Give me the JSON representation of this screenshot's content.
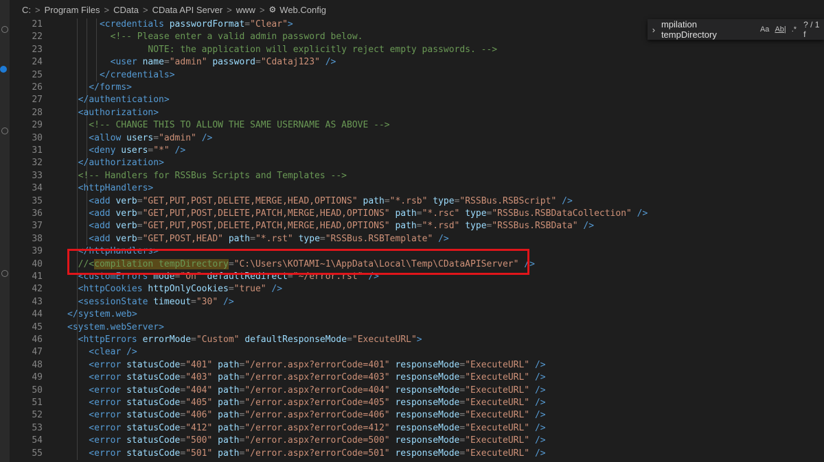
{
  "breadcrumb": [
    "C:",
    "Program Files",
    "CData",
    "CData API Server",
    "www",
    "Web.Config"
  ],
  "find_widget": {
    "term": "mpilation tempDirectory",
    "match_case": "Aa",
    "whole_word": "Ab|",
    "regex": ".*",
    "count": "? / 1 f"
  },
  "line_numbers": [
    "21",
    "22",
    "23",
    "24",
    "25",
    "26",
    "27",
    "28",
    "29",
    "30",
    "31",
    "32",
    "33",
    "34",
    "35",
    "36",
    "37",
    "38",
    "39",
    "40",
    "41",
    "42",
    "43",
    "44",
    "45",
    "46",
    "47",
    "48",
    "49",
    "50",
    "51",
    "52",
    "53",
    "54",
    "55"
  ],
  "code_lines": [
    [
      [
        "      <",
        "t"
      ],
      [
        "credentials",
        "t"
      ],
      [
        " passwordFormat",
        "a"
      ],
      [
        "=",
        "p"
      ],
      [
        "\"Clear\"",
        "s"
      ],
      [
        ">",
        "t"
      ]
    ],
    [
      [
        "        <!-- Please enter a valid admin password below.",
        "c"
      ]
    ],
    [
      [
        "               NOTE: the application will explicitly reject empty passwords. -->",
        "c"
      ]
    ],
    [
      [
        "        <",
        "t"
      ],
      [
        "user",
        "t"
      ],
      [
        " name",
        "a"
      ],
      [
        "=",
        "p"
      ],
      [
        "\"admin\"",
        "s"
      ],
      [
        " password",
        "a"
      ],
      [
        "=",
        "p"
      ],
      [
        "\"Cdataj123\"",
        "s"
      ],
      [
        " />",
        "t"
      ]
    ],
    [
      [
        "      </",
        "t"
      ],
      [
        "credentials",
        "t"
      ],
      [
        ">",
        "t"
      ]
    ],
    [
      [
        "    </",
        "t"
      ],
      [
        "forms",
        "t"
      ],
      [
        ">",
        "t"
      ]
    ],
    [
      [
        "  </",
        "t"
      ],
      [
        "authentication",
        "t"
      ],
      [
        ">",
        "t"
      ]
    ],
    [
      [
        "  <",
        "t"
      ],
      [
        "authorization",
        "t"
      ],
      [
        ">",
        "t"
      ]
    ],
    [
      [
        "    <!-- CHANGE THIS TO ALLOW THE SAME USERNAME AS ABOVE -->",
        "c"
      ]
    ],
    [
      [
        "    <",
        "t"
      ],
      [
        "allow",
        "t"
      ],
      [
        " users",
        "a"
      ],
      [
        "=",
        "p"
      ],
      [
        "\"admin\"",
        "s"
      ],
      [
        " />",
        "t"
      ]
    ],
    [
      [
        "    <",
        "t"
      ],
      [
        "deny",
        "t"
      ],
      [
        " users",
        "a"
      ],
      [
        "=",
        "p"
      ],
      [
        "\"*\"",
        "s"
      ],
      [
        " />",
        "t"
      ]
    ],
    [
      [
        "  </",
        "t"
      ],
      [
        "authorization",
        "t"
      ],
      [
        ">",
        "t"
      ]
    ],
    [
      [
        "  <!-- Handlers for RSSBus Scripts and Templates -->",
        "c"
      ]
    ],
    [
      [
        "  <",
        "t"
      ],
      [
        "httpHandlers",
        "t"
      ],
      [
        ">",
        "t"
      ]
    ],
    [
      [
        "    <",
        "t"
      ],
      [
        "add",
        "t"
      ],
      [
        " verb",
        "a"
      ],
      [
        "=",
        "p"
      ],
      [
        "\"GET,PUT,POST,DELETE,MERGE,HEAD,OPTIONS\"",
        "s"
      ],
      [
        " path",
        "a"
      ],
      [
        "=",
        "p"
      ],
      [
        "\"*.rsb\"",
        "s"
      ],
      [
        " type",
        "a"
      ],
      [
        "=",
        "p"
      ],
      [
        "\"RSSBus.RSBScript\"",
        "s"
      ],
      [
        " />",
        "t"
      ]
    ],
    [
      [
        "    <",
        "t"
      ],
      [
        "add",
        "t"
      ],
      [
        " verb",
        "a"
      ],
      [
        "=",
        "p"
      ],
      [
        "\"GET,PUT,POST,DELETE,PATCH,MERGE,HEAD,OPTIONS\"",
        "s"
      ],
      [
        " path",
        "a"
      ],
      [
        "=",
        "p"
      ],
      [
        "\"*.rsc\"",
        "s"
      ],
      [
        " type",
        "a"
      ],
      [
        "=",
        "p"
      ],
      [
        "\"RSSBus.RSBDataCollection\"",
        "s"
      ],
      [
        " />",
        "t"
      ]
    ],
    [
      [
        "    <",
        "t"
      ],
      [
        "add",
        "t"
      ],
      [
        " verb",
        "a"
      ],
      [
        "=",
        "p"
      ],
      [
        "\"GET,PUT,POST,DELETE,PATCH,MERGE,HEAD,OPTIONS\"",
        "s"
      ],
      [
        " path",
        "a"
      ],
      [
        "=",
        "p"
      ],
      [
        "\"*.rsd\"",
        "s"
      ],
      [
        " type",
        "a"
      ],
      [
        "=",
        "p"
      ],
      [
        "\"RSSBus.RSBData\"",
        "s"
      ],
      [
        " />",
        "t"
      ]
    ],
    [
      [
        "    <",
        "t"
      ],
      [
        "add",
        "t"
      ],
      [
        " verb",
        "a"
      ],
      [
        "=",
        "p"
      ],
      [
        "\"GET,POST,HEAD\"",
        "s"
      ],
      [
        " path",
        "a"
      ],
      [
        "=",
        "p"
      ],
      [
        "\"*.rst\"",
        "s"
      ],
      [
        " type",
        "a"
      ],
      [
        "=",
        "p"
      ],
      [
        "\"RSSBus.RSBTemplate\"",
        "s"
      ],
      [
        " />",
        "t"
      ]
    ],
    [
      [
        "  </",
        "t"
      ],
      [
        "httpHandlers",
        "t"
      ],
      [
        ">",
        "t"
      ]
    ],
    [
      [
        "  //<",
        "c"
      ],
      [
        "compilation tempDirectory",
        "chl"
      ],
      [
        "=",
        "p"
      ],
      [
        "\"C:\\Users\\KOTAMI~1\\AppData\\Local\\Temp\\CDataAPIServer\"",
        "s"
      ],
      [
        " />",
        "t"
      ]
    ],
    [
      [
        "  <",
        "t"
      ],
      [
        "customErrors",
        "t"
      ],
      [
        " mode",
        "a"
      ],
      [
        "=",
        "p"
      ],
      [
        "\"On\"",
        "s"
      ],
      [
        " defaultRedirect",
        "a"
      ],
      [
        "=",
        "p"
      ],
      [
        "\"~/error.rst\"",
        "s"
      ],
      [
        " />",
        "t"
      ]
    ],
    [
      [
        "  <",
        "t"
      ],
      [
        "httpCookies",
        "t"
      ],
      [
        " httpOnlyCookies",
        "a"
      ],
      [
        "=",
        "p"
      ],
      [
        "\"true\"",
        "s"
      ],
      [
        " />",
        "t"
      ]
    ],
    [
      [
        "  <",
        "t"
      ],
      [
        "sessionState",
        "t"
      ],
      [
        " timeout",
        "a"
      ],
      [
        "=",
        "p"
      ],
      [
        "\"30\"",
        "s"
      ],
      [
        " />",
        "t"
      ]
    ],
    [
      [
        "</",
        "t"
      ],
      [
        "system.web",
        "t"
      ],
      [
        ">",
        "t"
      ]
    ],
    [
      [
        "<",
        "t"
      ],
      [
        "system.webServer",
        "t"
      ],
      [
        ">",
        "t"
      ]
    ],
    [
      [
        "  <",
        "t"
      ],
      [
        "httpErrors",
        "t"
      ],
      [
        " errorMode",
        "a"
      ],
      [
        "=",
        "p"
      ],
      [
        "\"Custom\"",
        "s"
      ],
      [
        " defaultResponseMode",
        "a"
      ],
      [
        "=",
        "p"
      ],
      [
        "\"ExecuteURL\"",
        "s"
      ],
      [
        ">",
        "t"
      ]
    ],
    [
      [
        "    <",
        "t"
      ],
      [
        "clear",
        "t"
      ],
      [
        " />",
        "t"
      ]
    ],
    [
      [
        "    <",
        "t"
      ],
      [
        "error",
        "t"
      ],
      [
        " statusCode",
        "a"
      ],
      [
        "=",
        "p"
      ],
      [
        "\"401\"",
        "s"
      ],
      [
        " path",
        "a"
      ],
      [
        "=",
        "p"
      ],
      [
        "\"/error.aspx?errorCode=401\"",
        "s"
      ],
      [
        " responseMode",
        "a"
      ],
      [
        "=",
        "p"
      ],
      [
        "\"ExecuteURL\"",
        "s"
      ],
      [
        " />",
        "t"
      ]
    ],
    [
      [
        "    <",
        "t"
      ],
      [
        "error",
        "t"
      ],
      [
        " statusCode",
        "a"
      ],
      [
        "=",
        "p"
      ],
      [
        "\"403\"",
        "s"
      ],
      [
        " path",
        "a"
      ],
      [
        "=",
        "p"
      ],
      [
        "\"/error.aspx?errorCode=403\"",
        "s"
      ],
      [
        " responseMode",
        "a"
      ],
      [
        "=",
        "p"
      ],
      [
        "\"ExecuteURL\"",
        "s"
      ],
      [
        " />",
        "t"
      ]
    ],
    [
      [
        "    <",
        "t"
      ],
      [
        "error",
        "t"
      ],
      [
        " statusCode",
        "a"
      ],
      [
        "=",
        "p"
      ],
      [
        "\"404\"",
        "s"
      ],
      [
        " path",
        "a"
      ],
      [
        "=",
        "p"
      ],
      [
        "\"/error.aspx?errorCode=404\"",
        "s"
      ],
      [
        " responseMode",
        "a"
      ],
      [
        "=",
        "p"
      ],
      [
        "\"ExecuteURL\"",
        "s"
      ],
      [
        " />",
        "t"
      ]
    ],
    [
      [
        "    <",
        "t"
      ],
      [
        "error",
        "t"
      ],
      [
        " statusCode",
        "a"
      ],
      [
        "=",
        "p"
      ],
      [
        "\"405\"",
        "s"
      ],
      [
        " path",
        "a"
      ],
      [
        "=",
        "p"
      ],
      [
        "\"/error.aspx?errorCode=405\"",
        "s"
      ],
      [
        " responseMode",
        "a"
      ],
      [
        "=",
        "p"
      ],
      [
        "\"ExecuteURL\"",
        "s"
      ],
      [
        " />",
        "t"
      ]
    ],
    [
      [
        "    <",
        "t"
      ],
      [
        "error",
        "t"
      ],
      [
        " statusCode",
        "a"
      ],
      [
        "=",
        "p"
      ],
      [
        "\"406\"",
        "s"
      ],
      [
        " path",
        "a"
      ],
      [
        "=",
        "p"
      ],
      [
        "\"/error.aspx?errorCode=406\"",
        "s"
      ],
      [
        " responseMode",
        "a"
      ],
      [
        "=",
        "p"
      ],
      [
        "\"ExecuteURL\"",
        "s"
      ],
      [
        " />",
        "t"
      ]
    ],
    [
      [
        "    <",
        "t"
      ],
      [
        "error",
        "t"
      ],
      [
        " statusCode",
        "a"
      ],
      [
        "=",
        "p"
      ],
      [
        "\"412\"",
        "s"
      ],
      [
        " path",
        "a"
      ],
      [
        "=",
        "p"
      ],
      [
        "\"/error.aspx?errorCode=412\"",
        "s"
      ],
      [
        " responseMode",
        "a"
      ],
      [
        "=",
        "p"
      ],
      [
        "\"ExecuteURL\"",
        "s"
      ],
      [
        " />",
        "t"
      ]
    ],
    [
      [
        "    <",
        "t"
      ],
      [
        "error",
        "t"
      ],
      [
        " statusCode",
        "a"
      ],
      [
        "=",
        "p"
      ],
      [
        "\"500\"",
        "s"
      ],
      [
        " path",
        "a"
      ],
      [
        "=",
        "p"
      ],
      [
        "\"/error.aspx?errorCode=500\"",
        "s"
      ],
      [
        " responseMode",
        "a"
      ],
      [
        "=",
        "p"
      ],
      [
        "\"ExecuteURL\"",
        "s"
      ],
      [
        " />",
        "t"
      ]
    ],
    [
      [
        "    <",
        "t"
      ],
      [
        "error",
        "t"
      ],
      [
        " statusCode",
        "a"
      ],
      [
        "=",
        "p"
      ],
      [
        "\"501\"",
        "s"
      ],
      [
        " path",
        "a"
      ],
      [
        "=",
        "p"
      ],
      [
        "\"/error.aspx?errorCode=501\"",
        "s"
      ],
      [
        " responseMode",
        "a"
      ],
      [
        "=",
        "p"
      ],
      [
        "\"ExecuteURL\"",
        "s"
      ],
      [
        " />",
        "t"
      ]
    ]
  ]
}
